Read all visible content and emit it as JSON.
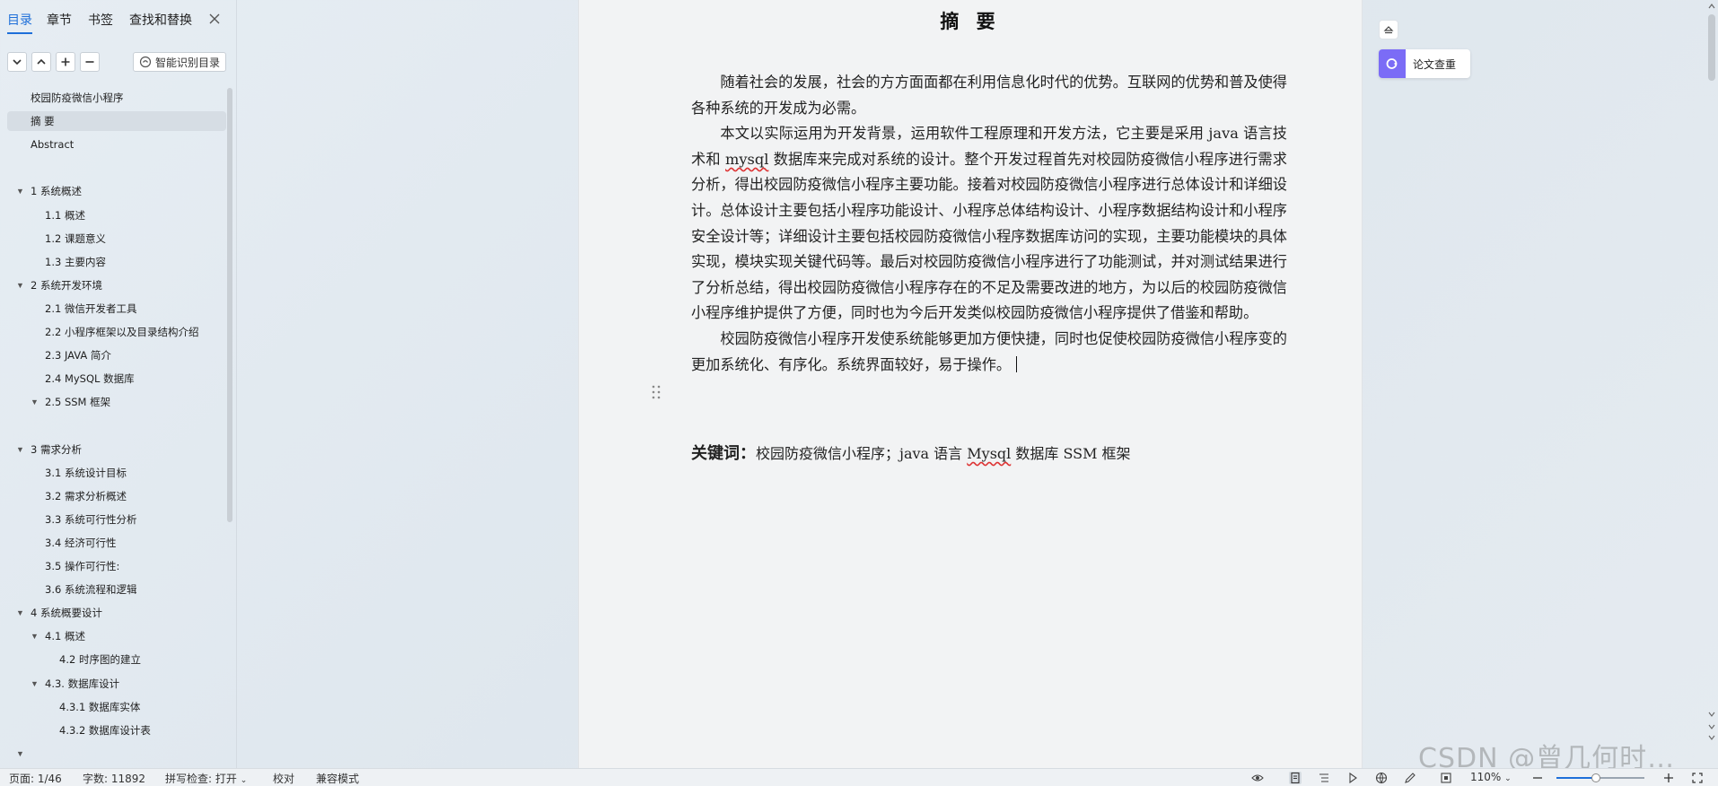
{
  "nav": {
    "tabs": [
      "目录",
      "章节",
      "书签",
      "查找和替换"
    ],
    "active_tab": 0,
    "smart_toc_label": "智能识别目录",
    "toc": [
      {
        "label": "校园防疫微信小程序",
        "level": 0,
        "arrow": "",
        "selected": false
      },
      {
        "label": "摘  要",
        "level": 0,
        "arrow": "",
        "selected": true
      },
      {
        "label": "Abstract",
        "level": 0,
        "arrow": "",
        "selected": false
      },
      {
        "label": "",
        "level": 0,
        "arrow": "",
        "selected": false
      },
      {
        "label": "1  系统概述",
        "level": 0,
        "arrow": "▼",
        "selected": false
      },
      {
        "label": "1.1  概述",
        "level": 1,
        "arrow": "",
        "selected": false
      },
      {
        "label": "1.2 课题意义",
        "level": 1,
        "arrow": "",
        "selected": false
      },
      {
        "label": "1.3  主要内容",
        "level": 1,
        "arrow": "",
        "selected": false
      },
      {
        "label": "2  系统开发环境",
        "level": 0,
        "arrow": "▼",
        "selected": false
      },
      {
        "label": "2.1 微信开发者工具",
        "level": 1,
        "arrow": "",
        "selected": false
      },
      {
        "label": "2.2 小程序框架以及目录结构介绍",
        "level": 1,
        "arrow": "",
        "selected": false
      },
      {
        "label": "2.3 JAVA 简介",
        "level": 1,
        "arrow": "",
        "selected": false
      },
      {
        "label": "2.4 MySQL 数据库",
        "level": 1,
        "arrow": "",
        "selected": false
      },
      {
        "label": "2.5 SSM 框架",
        "level": 1,
        "arrow": "▼",
        "selected": false
      },
      {
        "label": "",
        "level": 0,
        "arrow": "",
        "selected": false
      },
      {
        "label": "3  需求分析",
        "level": 0,
        "arrow": "▼",
        "selected": false
      },
      {
        "label": "3.1  系统设计目标",
        "level": 1,
        "arrow": "",
        "selected": false
      },
      {
        "label": "3.2 需求分析概述",
        "level": 1,
        "arrow": "",
        "selected": false
      },
      {
        "label": "3.3  系统可行性分析",
        "level": 1,
        "arrow": "",
        "selected": false
      },
      {
        "label": "3.4 经济可行性",
        "level": 1,
        "arrow": "",
        "selected": false
      },
      {
        "label": "3.5 操作可行性:",
        "level": 1,
        "arrow": "",
        "selected": false
      },
      {
        "label": "3.6 系统流程和逻辑",
        "level": 1,
        "arrow": "",
        "selected": false
      },
      {
        "label": "4 系统概要设计",
        "level": 0,
        "arrow": "▼",
        "selected": false
      },
      {
        "label": "4.1  概述",
        "level": 1,
        "arrow": "▼",
        "selected": false
      },
      {
        "label": "4.2  时序图的建立",
        "level": 2,
        "arrow": "",
        "selected": false
      },
      {
        "label": "4.3.  数据库设计",
        "level": 1,
        "arrow": "▼",
        "selected": false
      },
      {
        "label": "4.3.1  数据库实体",
        "level": 2,
        "arrow": "",
        "selected": false
      },
      {
        "label": "4.3.2  数据库设计表",
        "level": 2,
        "arrow": "",
        "selected": false
      },
      {
        "label": "",
        "level": 0,
        "arrow": "▼",
        "selected": false
      }
    ]
  },
  "document": {
    "heading": "摘 要",
    "paragraphs": [
      "随着社会的发展，社会的方方面面都在利用信息化时代的优势。互联网的优势和普及使得各种系统的开发成为必需。",
      "本文以实际运用为开发背景，运用软件工程原理和开发方法，它主要是采用 java 语言技术和 mysql 数据库来完成对系统的设计。整个开发过程首先对校园防疫微信小程序进行需求分析，得出校园防疫微信小程序主要功能。接着对校园防疫微信小程序进行总体设计和详细设计。总体设计主要包括小程序功能设计、小程序总体结构设计、小程序数据结构设计和小程序安全设计等；详细设计主要包括校园防疫微信小程序数据库访问的实现，主要功能模块的具体实现，模块实现关键代码等。最后对校园防疫微信小程序进行了功能测试，并对测试结果进行了分析总结，得出校园防疫微信小程序存在的不足及需要改进的地方，为以后的校园防疫微信小程序维护提供了方便，同时也为今后开发类似校园防疫微信小程序提供了借鉴和帮助。",
      "校园防疫微信小程序开发使系统能够更加方便快捷，同时也促使校园防疫微信小程序变的更加系统化、有序化。系统界面较好，易于操作。"
    ],
    "keywords_label": "关键词：",
    "keywords": "校园防疫微信小程序；java 语言  Mysql 数据库  SSM 框架"
  },
  "side_panel": {
    "plagiarism_label": "论文查重"
  },
  "watermark": "CSDN @曾几何时…",
  "status_bar": {
    "page": "页面: 1/46",
    "word_count": "字数: 11892",
    "spell_check": "拼写检查: 打开",
    "proofread": "校对",
    "compat_mode": "兼容模式",
    "zoom": "110%",
    "zoom_level_percent": 45
  },
  "colors": {
    "accent": "#1e6fd9",
    "plagiarism_icon_bg": "#7b6cf6",
    "page_bg": "#f2f3f4"
  }
}
